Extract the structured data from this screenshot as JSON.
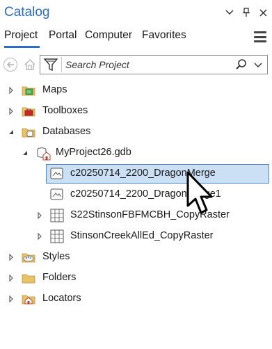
{
  "window": {
    "title": "Catalog",
    "icons": [
      "chevron-down-icon",
      "pin-icon",
      "close-icon"
    ]
  },
  "tabs": [
    {
      "label": "Project",
      "active": true
    },
    {
      "label": "Portal",
      "active": false
    },
    {
      "label": "Computer",
      "active": false
    },
    {
      "label": "Favorites",
      "active": false
    }
  ],
  "search": {
    "placeholder": "Search Project"
  },
  "tree": {
    "maps": "Maps",
    "toolboxes": "Toolboxes",
    "databases": "Databases",
    "gdb": "MyProject26.gdb",
    "raster1": "c20250714_2200_DragonMerge",
    "raster2": "c20250714_2200_DragonMerge1",
    "raster3": "S22StinsonFBFMCBH_CopyRaster",
    "raster4": "StinsonCreekAllEd_CopyRaster",
    "styles": "Styles",
    "folders": "Folders",
    "locators": "Locators"
  },
  "colors": {
    "accent": "#2b6cc4",
    "selection_bg": "#cce0f5",
    "selection_border": "#4a86c8",
    "folder": "#e8c36a"
  }
}
